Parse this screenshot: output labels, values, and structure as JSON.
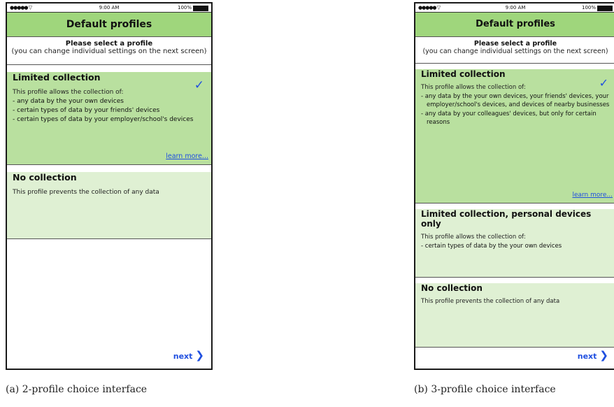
{
  "status_bar": {
    "signal": "●●●●● ▽",
    "time": "9:00 AM",
    "battery": "100%"
  },
  "nav_title": "Default profiles",
  "prompt": {
    "line1": "Please select a profile",
    "line2": "(you can change individual settings on the next screen)"
  },
  "learn_more": "learn more...",
  "next_label": "next",
  "check_glyph": "✓",
  "chevron_glyph": "❯",
  "colors": {
    "header": "#9fd67c",
    "selected": "#b9e09f",
    "unselected": "#dff0d3",
    "link": "#1f4fe0"
  },
  "screen_a": {
    "caption": "(a) 2-profile choice interface",
    "profiles": [
      {
        "title": "Limited collection",
        "selected": true,
        "intro": "This profile allows the collection of:",
        "bullets": [
          "- any data by the your own devices",
          "- certain types of data by your friends' devices",
          "- certain types of data by your employer/school's devices"
        ]
      },
      {
        "title": "No collection",
        "selected": false,
        "intro": "This profile prevents the collection of any data"
      }
    ]
  },
  "screen_b": {
    "caption": "(b) 3-profile choice interface",
    "profiles": [
      {
        "title": "Limited collection",
        "selected": true,
        "intro": "This profile allows the collection of:",
        "bullets": [
          "- any data by the your own devices, your friends' devices, your employer/school's devices, and devices of nearby businesses",
          "- any data by your colleagues' devices, but only for certain reasons"
        ]
      },
      {
        "title": "Limited collection, personal devices only",
        "selected": false,
        "intro": "This profile allows the collection of:",
        "bullets": [
          "- certain types of data by the your own devices"
        ]
      },
      {
        "title": "No collection",
        "selected": false,
        "intro": "This profile prevents the collection of any data"
      }
    ]
  }
}
